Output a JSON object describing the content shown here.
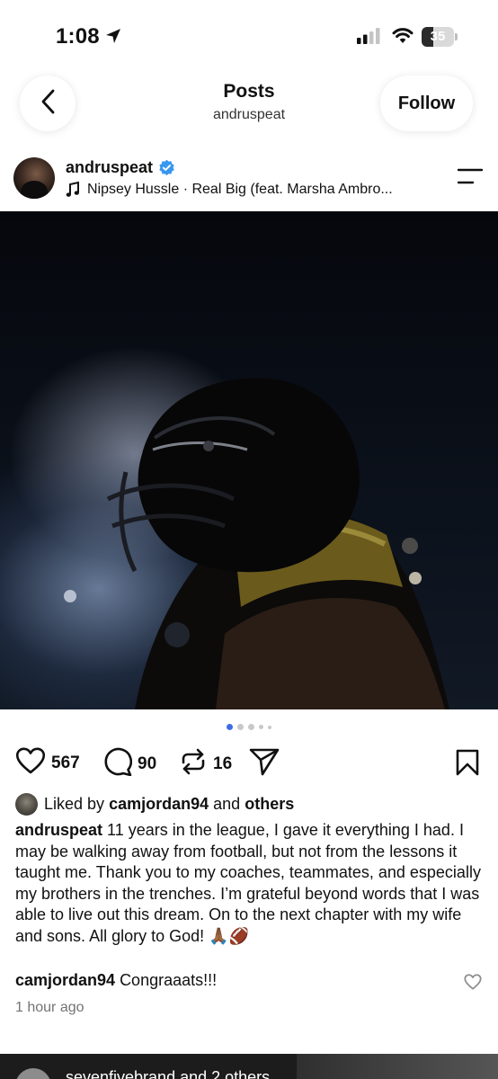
{
  "status_bar": {
    "time": "1:08",
    "battery": "35",
    "battery_level": 0.35
  },
  "header": {
    "title": "Posts",
    "subtitle": "andruspeat",
    "follow_label": "Follow"
  },
  "post": {
    "username": "andruspeat",
    "verified": true,
    "music": "Nipsey Hussle · Real Big (feat. Marsha Ambro...",
    "carousel": {
      "count": 5,
      "active_index": 0
    },
    "actions": {
      "likes": "567",
      "comments": "90",
      "reposts": "16"
    },
    "liked_by": {
      "prefix": "Liked by",
      "user": "camjordan94",
      "conjunction": "and",
      "others": "others"
    },
    "caption_user": "andruspeat",
    "caption_text": "11 years in the league, I gave it everything I had. I may be walking away from football, but not from the lessons it taught me. Thank you to my coaches, teammates, and especially my brothers in the trenches. I’m grateful beyond words that I was able to live out this dream. On to the next chapter with my wife and sons. All glory to God! 🙏🏾🏈",
    "comment": {
      "user": "camjordan94",
      "text": "Congraaats!!!"
    },
    "timestamp": "1 hour ago"
  },
  "next_post": {
    "username": "sevenfivebrand and 2 others"
  },
  "colors": {
    "accent_blue": "#3d6ce7",
    "verified_blue": "#3897f0",
    "muted_text": "#737373"
  },
  "icons": {
    "back": "chevron-left-icon",
    "verified": "verified-badge-icon",
    "music": "music-note-icon",
    "menu": "menu-icon",
    "mute": "speaker-muted-icon",
    "like": "heart-icon",
    "comment": "comment-bubble-icon",
    "repost": "repost-icon",
    "share": "send-icon",
    "save": "bookmark-icon"
  }
}
